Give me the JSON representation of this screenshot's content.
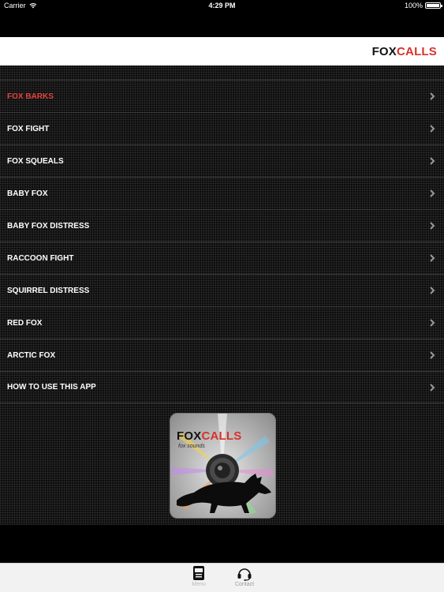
{
  "status": {
    "carrier": "Carrier",
    "time": "4:29 PM",
    "battery": "100%"
  },
  "header": {
    "brand_part1": "FOX",
    "brand_part2": "CALLS"
  },
  "menu": {
    "items": [
      {
        "label": "FOX BARKS",
        "active": true
      },
      {
        "label": "FOX FIGHT",
        "active": false
      },
      {
        "label": "FOX SQUEALS",
        "active": false
      },
      {
        "label": "BABY FOX",
        "active": false
      },
      {
        "label": "BABY FOX DISTRESS",
        "active": false
      },
      {
        "label": "RACCOON FIGHT",
        "active": false
      },
      {
        "label": "SQUIRREL DISTRESS",
        "active": false
      },
      {
        "label": "RED FOX",
        "active": false
      },
      {
        "label": "ARCTIC FOX",
        "active": false
      },
      {
        "label": "HOW TO USE THIS APP",
        "active": false
      }
    ]
  },
  "app_icon": {
    "title_part1": "FOX",
    "title_part2": "CALLS",
    "subtitle": "fox sounds"
  },
  "tabs": {
    "menu_label": "Menu",
    "contact_label": "Contact"
  },
  "colors": {
    "accent_red": "#d7322a",
    "active_item": "#e2453c",
    "background": "#000000"
  }
}
